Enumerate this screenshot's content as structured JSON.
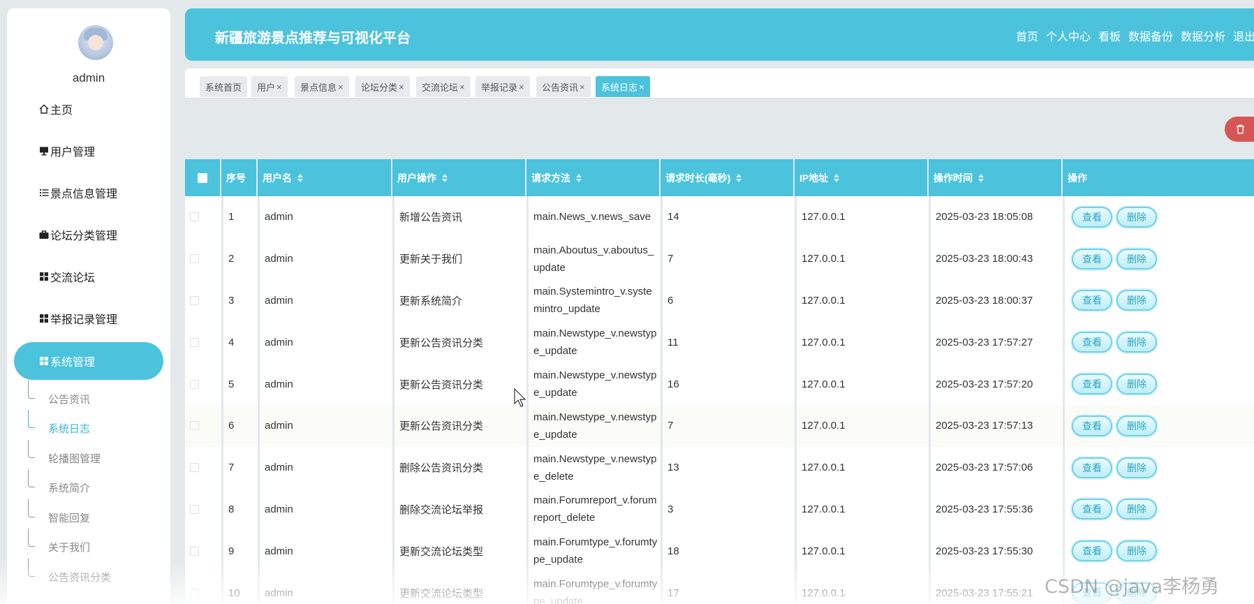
{
  "sidebar": {
    "username": "admin",
    "menu": [
      {
        "label": "主页",
        "icon": "home-icon"
      },
      {
        "label": "用户管理",
        "icon": "monitor-icon"
      },
      {
        "label": "景点信息管理",
        "icon": "list-icon"
      },
      {
        "label": "论坛分类管理",
        "icon": "briefcase-icon"
      },
      {
        "label": "交流论坛",
        "icon": "grid-icon"
      },
      {
        "label": "举报记录管理",
        "icon": "grid-icon"
      },
      {
        "label": "系统管理",
        "icon": "grid-icon",
        "active": true
      }
    ],
    "submenu": [
      {
        "label": "公告资讯"
      },
      {
        "label": "系统日志",
        "active": true
      },
      {
        "label": "轮播图管理"
      },
      {
        "label": "系统简介"
      },
      {
        "label": "智能回复"
      },
      {
        "label": "关于我们"
      },
      {
        "label": "公告资讯分类"
      }
    ]
  },
  "header": {
    "title": "新疆旅游景点推荐与可视化平台",
    "nav": [
      "首页",
      "个人中心",
      "看板",
      "数据备份",
      "数据分析",
      "退出"
    ]
  },
  "tabs": [
    {
      "label": "系统首页",
      "closable": false
    },
    {
      "label": "用户",
      "closable": true
    },
    {
      "label": "景点信息",
      "closable": true
    },
    {
      "label": "论坛分类",
      "closable": true
    },
    {
      "label": "交流论坛",
      "closable": true
    },
    {
      "label": "举报记录",
      "closable": true
    },
    {
      "label": "公告资讯",
      "closable": true
    },
    {
      "label": "系统日志",
      "closable": true,
      "active": true
    }
  ],
  "tab_close_glyph": "×",
  "table": {
    "headers": [
      "序号",
      "用户名",
      "用户操作",
      "请求方法",
      "请求时长(毫秒)",
      "IP地址",
      "操作时间",
      "操作"
    ],
    "view_label": "查看",
    "delete_label": "删除",
    "rows": [
      [
        "1",
        "admin",
        "新增公告资讯",
        "main.News_v.news_save",
        "14",
        "127.0.0.1",
        "2025-03-23 18:05:08"
      ],
      [
        "2",
        "admin",
        "更新关于我们",
        "main.Aboutus_v.aboutus_update",
        "7",
        "127.0.0.1",
        "2025-03-23 18:00:43"
      ],
      [
        "3",
        "admin",
        "更新系统简介",
        "main.Systemintro_v.systemintro_update",
        "6",
        "127.0.0.1",
        "2025-03-23 18:00:37"
      ],
      [
        "4",
        "admin",
        "更新公告资讯分类",
        "main.Newstype_v.newstype_update",
        "11",
        "127.0.0.1",
        "2025-03-23 17:57:27"
      ],
      [
        "5",
        "admin",
        "更新公告资讯分类",
        "main.Newstype_v.newstype_update",
        "16",
        "127.0.0.1",
        "2025-03-23 17:57:20"
      ],
      [
        "6",
        "admin",
        "更新公告资讯分类",
        "main.Newstype_v.newstype_update",
        "7",
        "127.0.0.1",
        "2025-03-23 17:57:13"
      ],
      [
        "7",
        "admin",
        "删除公告资讯分类",
        "main.Newstype_v.newstype_delete",
        "13",
        "127.0.0.1",
        "2025-03-23 17:57:06"
      ],
      [
        "8",
        "admin",
        "删除交流论坛举报",
        "main.Forumreport_v.forumreport_delete",
        "3",
        "127.0.0.1",
        "2025-03-23 17:55:36"
      ],
      [
        "9",
        "admin",
        "更新交流论坛类型",
        "main.Forumtype_v.forumtype_update",
        "18",
        "127.0.0.1",
        "2025-03-23 17:55:30"
      ],
      [
        "10",
        "admin",
        "更新交流论坛类型",
        "main.Forumtype_v.forumtype_update",
        "17",
        "127.0.0.1",
        "2025-03-23 17:55:21"
      ]
    ]
  },
  "batch_delete_icon": "trash-icon",
  "watermark": "CSDN @java李杨勇",
  "colors": {
    "accent": "#4cc3dc",
    "danger": "#d85555",
    "background": "#e3e8ea"
  }
}
